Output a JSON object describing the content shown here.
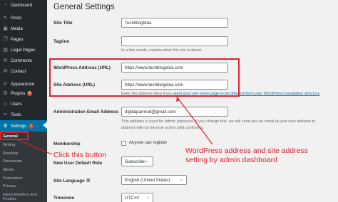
{
  "sidebar": {
    "items": [
      {
        "label": "Dashboard",
        "icon": "dashboard-icon"
      },
      {
        "label": "Posts",
        "icon": "pin-icon"
      },
      {
        "label": "Media",
        "icon": "media-icon"
      },
      {
        "label": "Pages",
        "icon": "pages-icon"
      },
      {
        "label": "Legal Pages",
        "icon": "legal-pages-icon"
      },
      {
        "label": "Comments",
        "icon": "comments-icon"
      },
      {
        "label": "Contact",
        "icon": "mail-icon"
      },
      {
        "label": "Appearance",
        "icon": "paintbrush-icon"
      },
      {
        "label": "Plugins",
        "icon": "plugin-icon",
        "badge": "6"
      },
      {
        "label": "Users",
        "icon": "users-icon"
      },
      {
        "label": "Tools",
        "icon": "wrench-icon"
      },
      {
        "label": "Settings",
        "icon": "settings-icon",
        "badge": "1"
      }
    ],
    "submenu": [
      "General",
      "Writing",
      "Reading",
      "Discussion",
      "Media",
      "Permalinks",
      "Privacy",
      "Insert Headers and Footers"
    ]
  },
  "main": {
    "title": "General Settings",
    "site_title": {
      "label": "Site Title",
      "value": "TechBlogIdea"
    },
    "tagline": {
      "label": "Tagline",
      "value": "",
      "description": "In a few words, explain what this site is about."
    },
    "wp_address": {
      "label": "WordPress Address (URL)",
      "value": "https://www.techblogidea.com"
    },
    "site_address": {
      "label": "Site Address (URL)",
      "value": "https://www.techblogidea.com",
      "description_prefix": "Enter the address here if you ",
      "description_link": "want your site home page to be different from your WordPress installation directory",
      "description_suffix": "."
    },
    "admin_email": {
      "label": "Administration Email Address",
      "value": "digitalparmod@gmail.com",
      "description_line1": "This address is used for admin purposes. If you change this, we will send you an email at your new address to",
      "description_line2": "address will not become active until confirmed."
    },
    "membership": {
      "label": "Membership",
      "checkbox_label": "Anyone can register"
    },
    "default_role": {
      "label": "New User Default Role",
      "value": "Subscriber"
    },
    "site_language": {
      "label": "Site Language",
      "value": "English (United States)",
      "icon": "translation-icon"
    },
    "timezone": {
      "label": "Timezone",
      "value": "UTC+0"
    }
  },
  "annotations": {
    "click_button": "Click this button",
    "address_line1": "WordPress address and site address",
    "address_line2": "setting by admin dashboard",
    "color": "#e0202c"
  }
}
